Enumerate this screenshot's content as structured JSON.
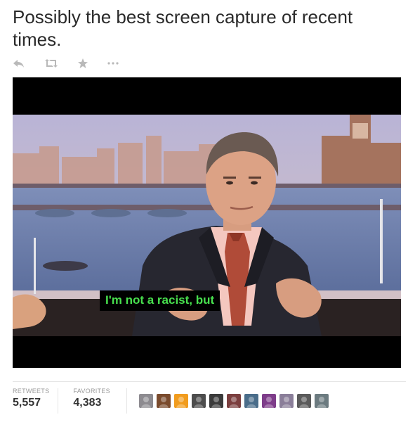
{
  "tweet": {
    "text": "Possibly the best screen capture of recent times."
  },
  "actions": {
    "icons": [
      "reply-icon",
      "retweet-icon",
      "favorite-icon",
      "more-icon"
    ],
    "color": "#b9b9b9"
  },
  "media": {
    "subtitle": "I'm not a racist, but",
    "subtitle_color": "#48e04e"
  },
  "stats": {
    "retweets_label": "RETWEETS",
    "retweets_value": "5,557",
    "favorites_label": "FAVORITES",
    "favorites_value": "4,383"
  },
  "avatars": {
    "count": 11,
    "colors": [
      "#8d8b90",
      "#7a4b2d",
      "#f19c1e",
      "#4d4d4d",
      "#3b3b3b",
      "#7b3f3f",
      "#4a6d8a",
      "#7e3d8a",
      "#8a7e99",
      "#5b5b5b",
      "#6c7b80"
    ]
  }
}
